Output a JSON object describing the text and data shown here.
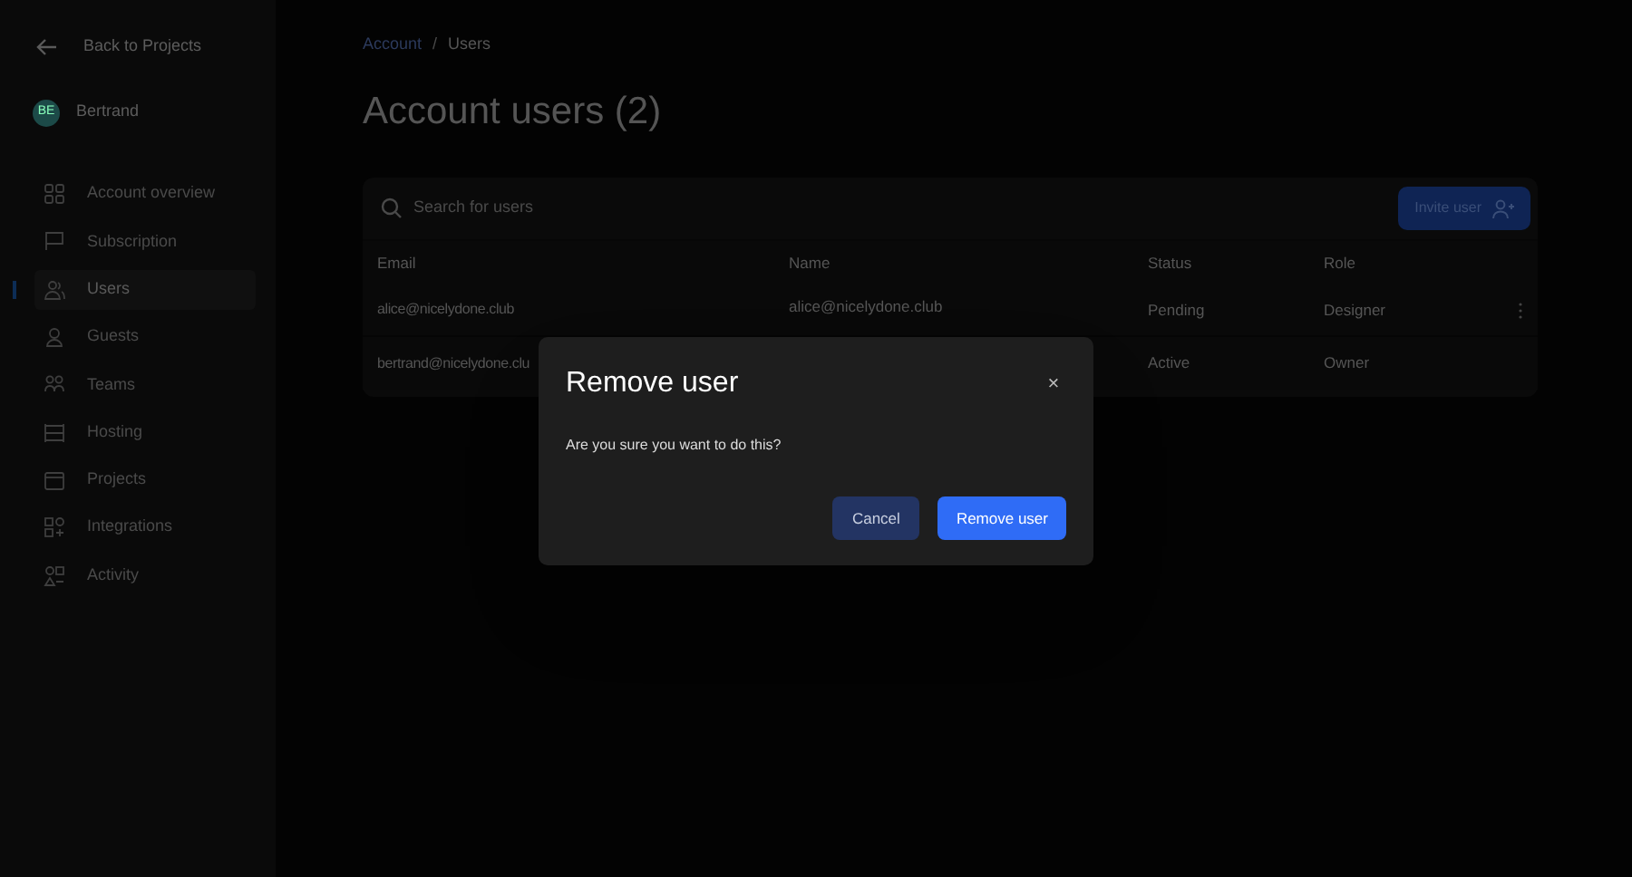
{
  "sidebar": {
    "back_link": "Back to Projects",
    "user": {
      "initials": "BE",
      "name": "Bertrand"
    },
    "items": [
      {
        "label": "Account overview",
        "selected": false
      },
      {
        "label": "Subscription",
        "selected": false
      },
      {
        "label": "Users",
        "selected": true
      },
      {
        "label": "Guests",
        "selected": false
      },
      {
        "label": "Teams",
        "selected": false
      },
      {
        "label": "Hosting",
        "selected": false
      },
      {
        "label": "Projects",
        "selected": false
      },
      {
        "label": "Integrations",
        "selected": false
      },
      {
        "label": "Activity",
        "selected": false
      }
    ]
  },
  "breadcrumb": [
    "Account",
    "/",
    "Users"
  ],
  "title": "Account users (2)",
  "search": {
    "placeholder": "Search for users"
  },
  "invite_button": "Invite user",
  "table": {
    "columns": [
      "Email",
      "Name",
      "Status",
      "Role"
    ],
    "rows": [
      {
        "email": "alice@nicelydone.club",
        "name": "alice@nicelydone.club",
        "status": "Pending",
        "role": "Designer",
        "menu": true
      },
      {
        "email": "bertrand@nicelydone.clu",
        "status": "Active",
        "role": "Owner",
        "menu": false
      }
    ]
  },
  "dialog": {
    "title": "Remove user",
    "close": "×",
    "message": "Are you sure you want to do this?",
    "buttons": [
      {
        "label": "Cancel",
        "kind": "secondary"
      },
      {
        "label": "Remove user",
        "kind": "primary"
      }
    ]
  }
}
